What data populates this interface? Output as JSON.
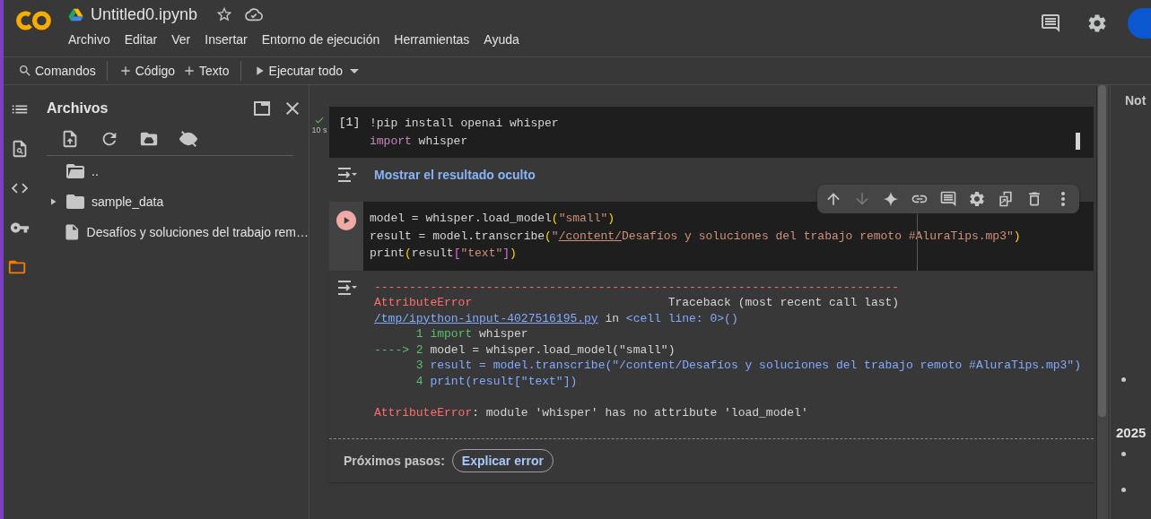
{
  "header": {
    "title": "Untitled0.ipynb",
    "menu": [
      "Archivo",
      "Editar",
      "Ver",
      "Insertar",
      "Entorno de ejecución",
      "Herramientas",
      "Ayuda"
    ]
  },
  "toolbar": [
    {
      "label": "Comandos"
    },
    {
      "label": "Código"
    },
    {
      "label": "Texto"
    },
    {
      "label": "Ejecutar todo",
      "dropdown": true
    }
  ],
  "side_rail": [
    {
      "selected": false
    },
    {
      "selected": false
    },
    {
      "selected": false
    },
    {
      "selected": false
    },
    {
      "selected": true
    }
  ],
  "file_panel": {
    "title": "Archivos",
    "files": [
      {
        "name": "..",
        "kind": "parent"
      },
      {
        "name": "sample_data",
        "kind": "folder",
        "expanded": false
      },
      {
        "name": "Desafíos y soluciones del trabajo rem…",
        "kind": "file"
      }
    ]
  },
  "cells": [
    {
      "kind": "done",
      "time": "10 s",
      "count": "[1]",
      "selected": false,
      "lines": [
        [
          {
            "text": "!pip install openai whisper",
            "kind": "plain"
          }
        ],
        [
          {
            "text": "import",
            "kind": "kw"
          },
          {
            "text": " whisper",
            "kind": "plain"
          }
        ]
      ],
      "output": {
        "kind": "hidden",
        "label": "Mostrar el resultado oculto"
      }
    },
    {
      "kind": "run",
      "selected": true,
      "lines": [
        [
          {
            "text": "model = whisper.load_model",
            "kind": "plain"
          },
          {
            "text": "(",
            "kind": "br1"
          },
          {
            "text": "\"small\"",
            "kind": "str"
          },
          {
            "text": ")",
            "kind": "br1"
          }
        ],
        [
          {
            "text": "result = model.transcribe",
            "kind": "plain"
          },
          {
            "text": "(",
            "kind": "br1"
          },
          {
            "text": "\"",
            "kind": "str"
          },
          {
            "text": "/content/",
            "kind": "strlink"
          },
          {
            "text": "Desafíos y soluciones del trabajo remoto #AluraTips.mp3\"",
            "kind": "str"
          },
          {
            "text": ")",
            "kind": "br1"
          }
        ],
        [
          {
            "text": "print",
            "kind": "plain"
          },
          {
            "text": "(",
            "kind": "br1"
          },
          {
            "text": "result",
            "kind": "plain"
          },
          {
            "text": "[",
            "kind": "br2"
          },
          {
            "text": "\"text\"",
            "kind": "str"
          },
          {
            "text": "]",
            "kind": "br2"
          },
          {
            "text": ")",
            "kind": "br1"
          }
        ]
      ],
      "output": {
        "kind": "error",
        "traceback": [
          [
            {
              "text": "---------------------------------------------------------------------------",
              "kind": "err"
            }
          ],
          [
            {
              "text": "AttributeError",
              "kind": "err"
            },
            {
              "text": "                            Traceback (most recent call last)",
              "kind": "plain"
            }
          ],
          [
            {
              "text": "/tmp/ipython-input-4027516195.py",
              "kind": "link"
            },
            {
              "text": " in ",
              "kind": "plain"
            },
            {
              "text": "<cell line: 0>()",
              "kind": "blu"
            }
          ],
          [
            {
              "text": "      1 ",
              "kind": "grn"
            },
            {
              "text": "import",
              "kind": "grn"
            },
            {
              "text": " whisper",
              "kind": "plain"
            }
          ],
          [
            {
              "text": "----> 2 ",
              "kind": "grn"
            },
            {
              "text": "model = whisper.load_model(\"small\")",
              "kind": "plain"
            }
          ],
          [
            {
              "text": "      3 ",
              "kind": "grn"
            },
            {
              "text": "result = model.transcribe(\"/content/Desafíos y soluciones del trabajo remoto #AluraTips.mp3\")",
              "kind": "blu"
            }
          ],
          [
            {
              "text": "      4 ",
              "kind": "grn"
            },
            {
              "text": "print(result[\"text\"])",
              "kind": "blu"
            }
          ]
        ],
        "message": [
          {
            "text": "AttributeError",
            "kind": "err"
          },
          {
            "text": ": module 'whisper' has no attribute 'load_model'",
            "kind": "plain"
          }
        ],
        "next_steps_label": "Próximos pasos:",
        "next_steps_button": "Explicar error"
      }
    }
  ],
  "cell_toolbar": [
    {
      "disabled": false
    },
    {
      "disabled": true
    },
    {
      "disabled": false
    },
    {
      "disabled": false
    },
    {
      "disabled": false
    },
    {
      "disabled": false
    },
    {
      "disabled": false
    },
    {
      "disabled": false
    },
    {
      "disabled": false
    }
  ],
  "right_panel": {
    "tab": "Not",
    "heading": "2025"
  }
}
